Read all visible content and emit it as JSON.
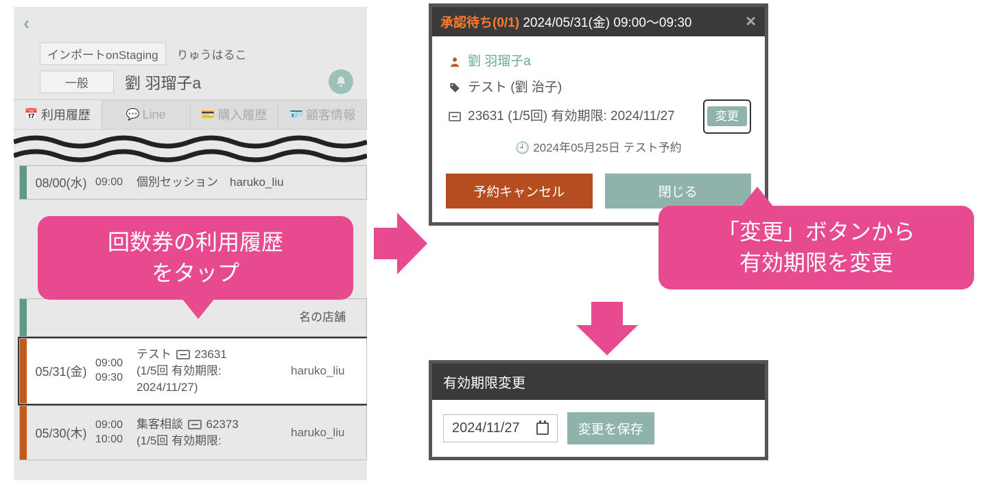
{
  "left": {
    "pill1": "インポートonStaging",
    "pill2": "一般",
    "nameKana": "りゅうはるこ",
    "nameMain": "劉 羽瑠子a",
    "tabs": {
      "history": "利用履歴",
      "line": "Line",
      "purchase": "購入履歴",
      "customer": "顧客情報"
    },
    "rows": {
      "r1": {
        "time1": "09:00",
        "body": "個別セッション　haruko_liu"
      },
      "r2": {
        "bodySuffix": "名の店舗"
      },
      "r3": {
        "date": "05/31(金)",
        "time1": "09:00",
        "time2": "09:30",
        "prefix": "テスト",
        "ticketNo": "23631",
        "line2": "(1/5回 有効期限:",
        "line3": "2024/11/27)",
        "user": "haruko_liu"
      },
      "r4": {
        "date": "05/30(木)",
        "time1": "09:00",
        "time2": "10:00",
        "prefix": "集客相談",
        "ticketNo": "62373",
        "line2": "(1/5回 有効期限:",
        "user": "haruko_liu"
      }
    }
  },
  "calloutLeft": {
    "line1": "回数券の利用履歴",
    "line2": "をタップ"
  },
  "calloutRight": {
    "line1": "「変更」ボタンから",
    "line2": "有効期限を変更"
  },
  "modalTop": {
    "statusLabel": "承認待ち(0/1)",
    "dateTime": "2024/05/31(金) 09:00〜09:30",
    "userName": "劉 羽瑠子a",
    "tagText": "テスト (劉 治子)",
    "ticketText": "23631 (1/5回) 有効期限: 2024/11/27",
    "changeBtn": "変更",
    "audit": "2024年05月25日 テスト予約",
    "cancelBtn": "予約キャンセル",
    "closeBtn": "閉じる"
  },
  "modalBottom": {
    "header": "有効期限変更",
    "dateValue": "2024/11/27",
    "saveBtn": "変更を保存"
  }
}
